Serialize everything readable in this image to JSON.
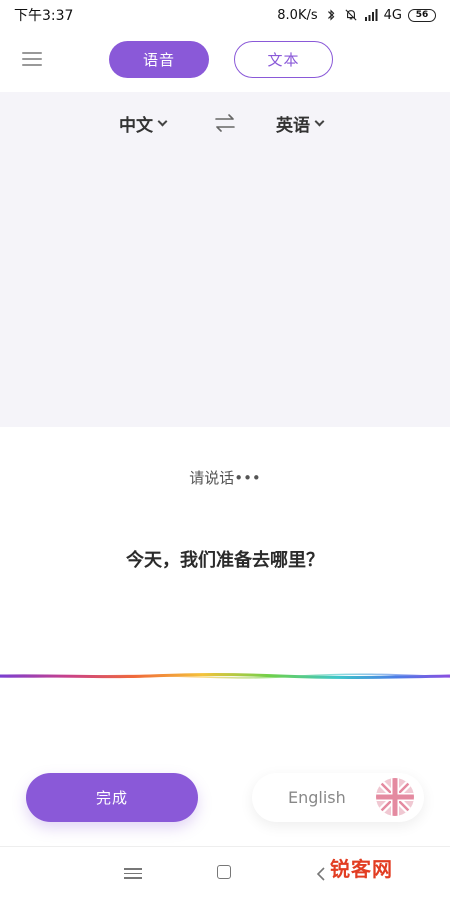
{
  "status_bar": {
    "time": "下午3:37",
    "network_speed": "8.0K/s",
    "network_type": "4G",
    "battery": "56"
  },
  "header": {
    "tabs": [
      {
        "label": "语音",
        "active": true
      },
      {
        "label": "文本",
        "active": false
      }
    ]
  },
  "languages": {
    "source": "中文",
    "target": "英语"
  },
  "main": {
    "prompt": "请说话•••",
    "transcript": "今天，我们准备去哪里？"
  },
  "actions": {
    "done_label": "完成",
    "output_language": "English"
  },
  "watermark": "锐客网",
  "colors": {
    "accent": "#8a59d8",
    "panel_bg": "#f5f4f9",
    "watermark": "#e23d22"
  }
}
